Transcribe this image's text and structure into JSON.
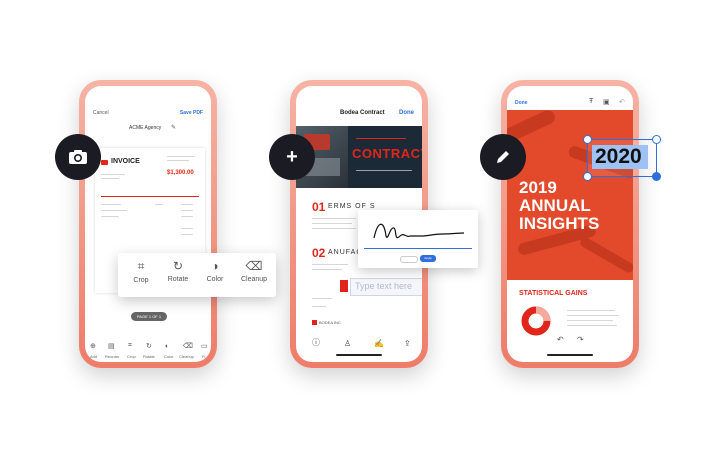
{
  "phone1": {
    "cancel": "Cancel",
    "save_pdf": "Save PDF",
    "doc_title": "ACME Agency",
    "invoice_title": "INVOICE",
    "invoice_total": "$1,300.00",
    "page_indicator": "PAGE 1 OF 1",
    "toolbar": [
      {
        "label": "Add",
        "icon": "plus-icon"
      },
      {
        "label": "Reorder",
        "icon": "reorder-icon"
      },
      {
        "label": "Crop",
        "icon": "crop-icon"
      },
      {
        "label": "Rotate",
        "icon": "rotate-icon"
      },
      {
        "label": "Color",
        "icon": "color-icon"
      },
      {
        "label": "Cleanup",
        "icon": "eraser-icon"
      },
      {
        "label": "Fi",
        "icon": "file-icon"
      }
    ],
    "popup": [
      {
        "label": "Crop",
        "icon": "crop-icon"
      },
      {
        "label": "Rotate",
        "icon": "rotate-icon"
      },
      {
        "label": "Color",
        "icon": "color-icon"
      },
      {
        "label": "Cleanup",
        "icon": "eraser-icon"
      }
    ]
  },
  "phone2": {
    "title": "Bodea Contract",
    "done": "Done",
    "hero_word": "CONTRACT",
    "section1_num": "01",
    "section1_text": "ERMS OF S",
    "section2_num": "02",
    "section2_text": "ANUFACTU",
    "type_placeholder": "Type text here",
    "signature_apply": "Apply",
    "footer_brand": "BODEA INC"
  },
  "phone3": {
    "done": "Done",
    "year": "2019",
    "heading_line1": "ANNUAL",
    "heading_line2": "INSIGHTS",
    "edit_box_value": "2020",
    "section_heading": "STATISTICAL GAINS"
  },
  "colors": {
    "brand_red": "#e1251b",
    "accent_blue": "#2f6fdc",
    "badge_dark": "#1b1b23",
    "phone_frame": "#ee7c68"
  }
}
